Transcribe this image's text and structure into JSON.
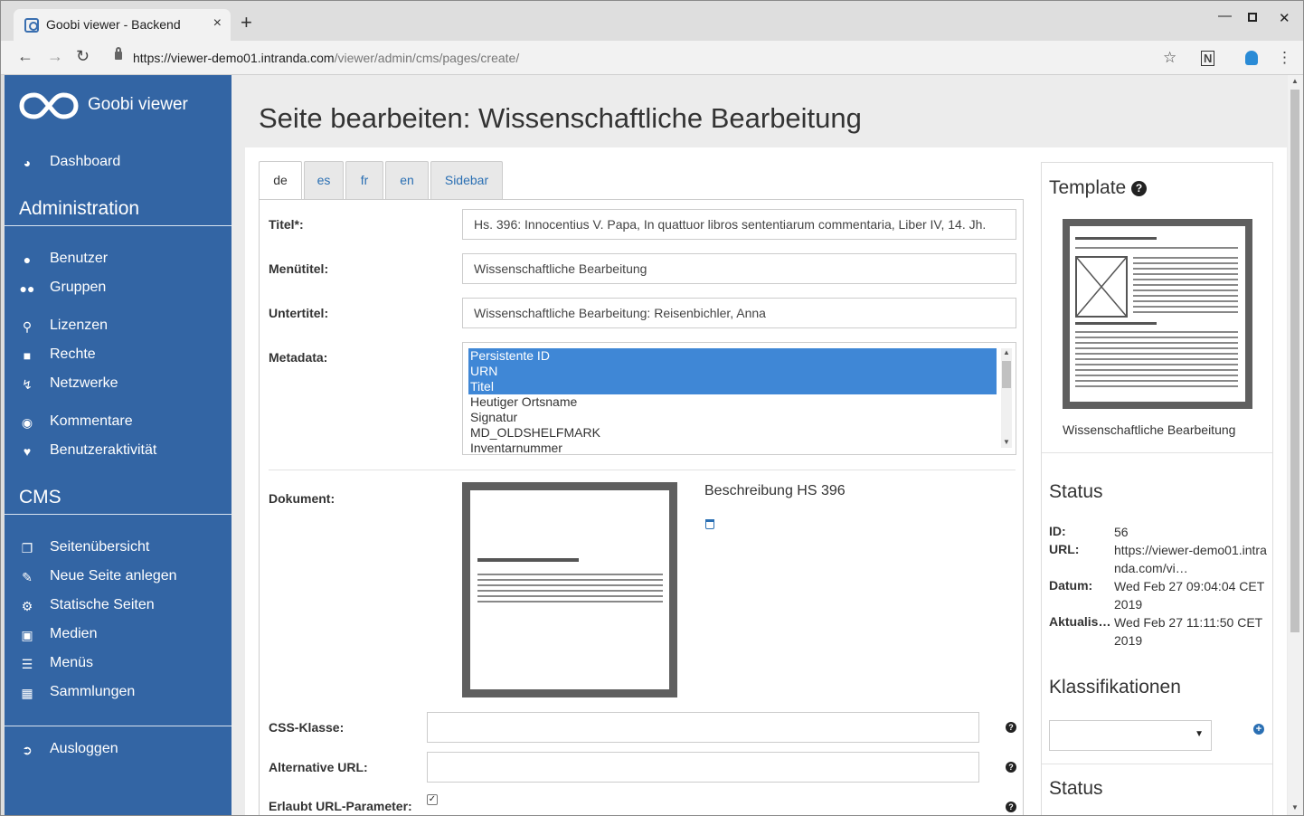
{
  "browser": {
    "tab_title": "Goobi viewer - Backend",
    "tab_close": "×",
    "new_tab": "+",
    "url_host": "https://viewer-demo01.intranda.com",
    "url_path": "/viewer/admin/cms/pages/create/"
  },
  "sidebar": {
    "brand": "Goobi viewer",
    "dashboard": "Dashboard",
    "admin_heading": "Administration",
    "admin_items": [
      {
        "label": "Benutzer",
        "icon": "user-icon"
      },
      {
        "label": "Gruppen",
        "icon": "users-icon"
      },
      {
        "label": "Lizenzen",
        "icon": "key-icon"
      },
      {
        "label": "Rechte",
        "icon": "lock-icon"
      },
      {
        "label": "Netzwerke",
        "icon": "bolt-icon"
      },
      {
        "label": "Kommentare",
        "icon": "comments-icon"
      },
      {
        "label": "Benutzeraktivität",
        "icon": "heartbeat-icon"
      }
    ],
    "cms_heading": "CMS",
    "cms_items": [
      {
        "label": "Seitenübersicht",
        "icon": "pages-icon"
      },
      {
        "label": "Neue Seite anlegen",
        "icon": "edit-icon"
      },
      {
        "label": "Statische Seiten",
        "icon": "cogs-icon"
      },
      {
        "label": "Medien",
        "icon": "image-icon"
      },
      {
        "label": "Menüs",
        "icon": "bars-icon"
      },
      {
        "label": "Sammlungen",
        "icon": "collections-icon"
      }
    ],
    "logout": "Ausloggen"
  },
  "main": {
    "title": "Seite bearbeiten: Wissenschaftliche Bearbeitung",
    "tabs": [
      "de",
      "es",
      "fr",
      "en",
      "Sidebar"
    ],
    "active_tab": "de",
    "fields": {
      "titel_label": "Titel*:",
      "titel_value": "Hs. 396: Innocentius V. Papa, In quattuor libros sententiarum commentaria, Liber IV, 14. Jh.",
      "menutitel_label": "Menütitel:",
      "menutitel_value": "Wissenschaftliche Bearbeitung",
      "untertitel_label": "Untertitel:",
      "untertitel_value": "Wissenschaftliche Bearbeitung: Reisenbichler, Anna",
      "metadata_label": "Metadata:",
      "metadata_options": [
        {
          "label": "Persistente ID",
          "selected": true
        },
        {
          "label": "URN",
          "selected": true
        },
        {
          "label": "Titel",
          "selected": true
        },
        {
          "label": "Heutiger Ortsname",
          "selected": false
        },
        {
          "label": "Signatur",
          "selected": false
        },
        {
          "label": "MD_OLDSHELFMARK",
          "selected": false
        },
        {
          "label": "Inventarnummer",
          "selected": false
        }
      ],
      "dokument_label": "Dokument:",
      "dokument_name": "Beschreibung HS 396",
      "css_label": "CSS-Klasse:",
      "css_value": "",
      "alt_url_label": "Alternative URL:",
      "alt_url_value": "",
      "url_param_label": "Erlaubt URL-Parameter:",
      "url_param_checked": true
    }
  },
  "right": {
    "template_heading": "Template",
    "template_name": "Wissenschaftliche Bearbeitung",
    "status_heading": "Status",
    "status": {
      "id_key": "ID:",
      "id_val": "56",
      "url_key": "URL:",
      "url_val": "https://viewer-demo01.intranda.com/vi…",
      "datum_key": "Datum:",
      "datum_val": "Wed Feb 27 09:04:04 CET 2019",
      "aktual_key": "Aktualis…",
      "aktual_val": "Wed Feb 27 11:11:50 CET 2019"
    },
    "klass_heading": "Klassifikationen",
    "status2_heading": "Status"
  },
  "colors": {
    "sidebar": "#3365a4",
    "selection": "#3f87d6",
    "link": "#2a6fb3"
  }
}
